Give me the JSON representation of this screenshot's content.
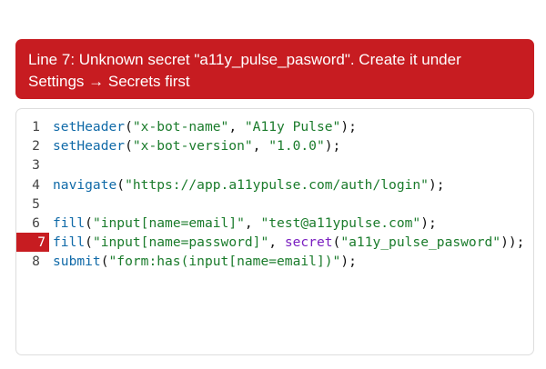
{
  "error_banner": {
    "message_line1": "Line 7: Unknown secret \"a11y_pulse_pasword\". Create it under",
    "message_line2": "Settings → Secrets first"
  },
  "editor": {
    "error_line": 7,
    "lines": [
      {
        "number": "1",
        "tokens": [
          {
            "t": "fn",
            "v": "setHeader"
          },
          {
            "t": "punc",
            "v": "("
          },
          {
            "t": "str",
            "v": "\"x-bot-name\""
          },
          {
            "t": "punc",
            "v": ", "
          },
          {
            "t": "str",
            "v": "\"A11y Pulse\""
          },
          {
            "t": "punc",
            "v": ");"
          }
        ]
      },
      {
        "number": "2",
        "tokens": [
          {
            "t": "fn",
            "v": "setHeader"
          },
          {
            "t": "punc",
            "v": "("
          },
          {
            "t": "str",
            "v": "\"x-bot-version\""
          },
          {
            "t": "punc",
            "v": ", "
          },
          {
            "t": "str",
            "v": "\"1.0.0\""
          },
          {
            "t": "punc",
            "v": ");"
          }
        ]
      },
      {
        "number": "3",
        "tokens": []
      },
      {
        "number": "4",
        "tokens": [
          {
            "t": "fn",
            "v": "navigate"
          },
          {
            "t": "punc",
            "v": "("
          },
          {
            "t": "str",
            "v": "\"https://app.a11ypulse.com/auth/login\""
          },
          {
            "t": "punc",
            "v": ");"
          }
        ]
      },
      {
        "number": "5",
        "tokens": []
      },
      {
        "number": "6",
        "tokens": [
          {
            "t": "fn",
            "v": "fill"
          },
          {
            "t": "punc",
            "v": "("
          },
          {
            "t": "str",
            "v": "\"input[name=email]\""
          },
          {
            "t": "punc",
            "v": ", "
          },
          {
            "t": "str",
            "v": "\"test@a11ypulse.com\""
          },
          {
            "t": "punc",
            "v": ");"
          }
        ]
      },
      {
        "number": "7",
        "tokens": [
          {
            "t": "fn",
            "v": "fill"
          },
          {
            "t": "punc",
            "v": "("
          },
          {
            "t": "str",
            "v": "\"input[name=password]\""
          },
          {
            "t": "punc",
            "v": ", "
          },
          {
            "t": "kw",
            "v": "secret"
          },
          {
            "t": "punc",
            "v": "("
          },
          {
            "t": "str",
            "v": "\"a11y_pulse_pasword\""
          },
          {
            "t": "punc",
            "v": "));"
          }
        ]
      },
      {
        "number": "8",
        "tokens": [
          {
            "t": "fn",
            "v": "submit"
          },
          {
            "t": "punc",
            "v": "("
          },
          {
            "t": "str",
            "v": "\"form:has(input[name=email])\""
          },
          {
            "t": "punc",
            "v": ");"
          }
        ]
      }
    ]
  },
  "colors": {
    "error_red": "#c71c21",
    "function": "#106aa8",
    "string": "#1a7b2b",
    "keyword": "#7a1fc0"
  }
}
